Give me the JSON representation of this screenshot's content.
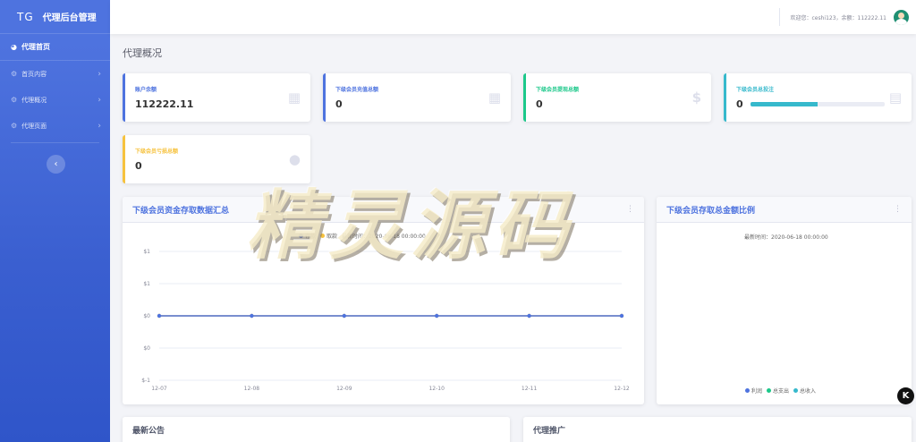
{
  "sidebar": {
    "logo": "TG",
    "title": "代理后台管理",
    "home": "代理首页",
    "items": [
      {
        "label": "首页内容",
        "icon": "gear-icon"
      },
      {
        "label": "代理概况",
        "icon": "gear-icon"
      },
      {
        "label": "代理页面",
        "icon": "gear-icon"
      }
    ],
    "toggle_icon": "‹"
  },
  "topbar": {
    "welcome": "欢迎您：ceshi123，余额：112222.11"
  },
  "page": {
    "title": "代理概况"
  },
  "stats": [
    {
      "label": "账户余额",
      "value": "112222.11",
      "icon": "calendar-icon"
    },
    {
      "label": "下级会员充值总额",
      "value": "0",
      "icon": "calendar-icon"
    },
    {
      "label": "下级会员提现总额",
      "value": "0",
      "icon": "dollar-icon"
    },
    {
      "label": "下级会员总投注",
      "value": "0",
      "icon": "clipboard-icon",
      "progress": 0.5
    },
    {
      "label": "下级会员亏损总额",
      "value": "0",
      "icon": "comments-icon"
    }
  ],
  "panels": {
    "line_title": "下级会员资金存取数据汇总",
    "pie_title": "下级会员存取总金额比例",
    "pie_updated": "最新时间：2020-06-18 00:00:00",
    "notice_title": "最新公告",
    "promo_title": "代理推广"
  },
  "chart_data": [
    {
      "type": "line",
      "title": "下级会员资金存取数据汇总",
      "categories": [
        "12-07",
        "12-08",
        "12-09",
        "12-10",
        "12-11",
        "12-12"
      ],
      "y_tick_labels": [
        "$1",
        "$1",
        "$0",
        "$0",
        "$-1"
      ],
      "series": [
        {
          "name": "存款",
          "values": [
            0,
            0,
            0,
            0,
            0,
            0
          ],
          "color": "#4e73df"
        },
        {
          "name": "取款",
          "values": [
            0,
            0,
            0,
            0,
            0,
            0
          ],
          "color": "#f6c23e"
        }
      ],
      "legend_note": "最新时间：2020-06-18 00:00:00",
      "ylim": [
        -1,
        1
      ],
      "grid": true
    },
    {
      "type": "pie",
      "title": "下级会员存取总金额比例",
      "categories": [
        "利润",
        "总支出",
        "总收入"
      ],
      "values": [
        0,
        0,
        0
      ],
      "colors": [
        "#4e73df",
        "#1cc88a",
        "#36b9cc"
      ]
    }
  ],
  "watermark": "精灵源码"
}
